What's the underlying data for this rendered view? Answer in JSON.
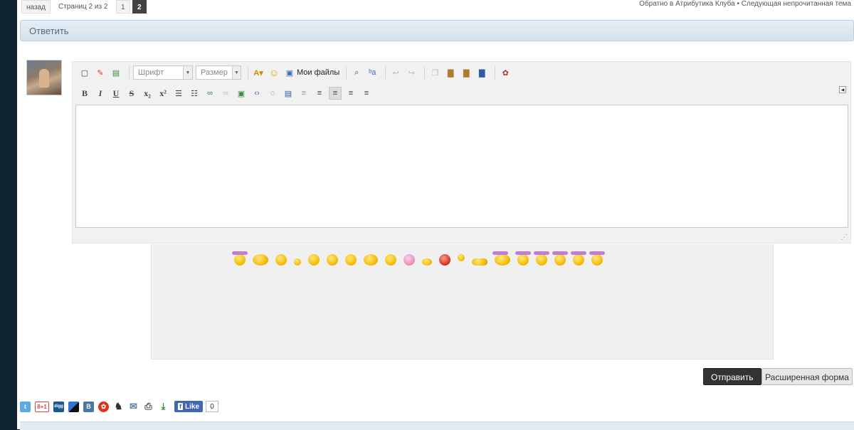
{
  "pagination": {
    "back_label": "назад",
    "pages_text": "Страниц 2 из 2",
    "pages": [
      "1",
      "2"
    ],
    "current_page": "2"
  },
  "top_links": {
    "back_to_forum": "Обратно в Атрибутика Клуба",
    "separator": "•",
    "next_unread": "Следующая непрочитанная тема"
  },
  "reply": {
    "title": "Ответить"
  },
  "editor": {
    "font_select": "Шрифт",
    "size_select": "Размер",
    "my_files_label": "Мои файлы",
    "text_value": "",
    "toolbar_row1_icons": [
      "source-icon",
      "eraser-icon",
      "remove-format-icon",
      "text-color-icon",
      "smiley-icon",
      "my-files-icon",
      "find-icon",
      "replace-icon",
      "undo-icon",
      "redo-icon",
      "copy-icon",
      "paste-icon",
      "paste-text-icon",
      "paste-word-icon",
      "spellcheck-icon"
    ],
    "toolbar_row2_icons": [
      "bold-icon",
      "italic-icon",
      "underline-icon",
      "strikethrough-icon",
      "subscript-icon",
      "superscript-icon",
      "bulleted-list-icon",
      "numbered-list-icon",
      "link-icon",
      "unlink-icon",
      "image-icon",
      "code-icon",
      "quote-icon",
      "special-block-icon",
      "align-left-icon",
      "align-justify-icon",
      "align-center-icon",
      "align-right-icon"
    ]
  },
  "buttons": {
    "send": "Отправить",
    "extended_form": "Расширенная форма"
  },
  "share": {
    "icons": [
      "twitter-icon",
      "google-plus-icon",
      "digg-icon",
      "delicious-icon",
      "vkontakte-icon",
      "odnoklassniki-icon",
      "moi-mir-icon",
      "email-icon",
      "print-icon",
      "download-icon"
    ],
    "gplus_label": "8+1",
    "digg_label": "digg",
    "vk_label": "B",
    "fb_like_label": "Like",
    "fb_count": "0"
  },
  "colors": {
    "sidebar_bg": "#0e2433",
    "reply_bar": "#d5e2ec",
    "send_button": "#333333",
    "fb_blue": "#4267b2"
  }
}
